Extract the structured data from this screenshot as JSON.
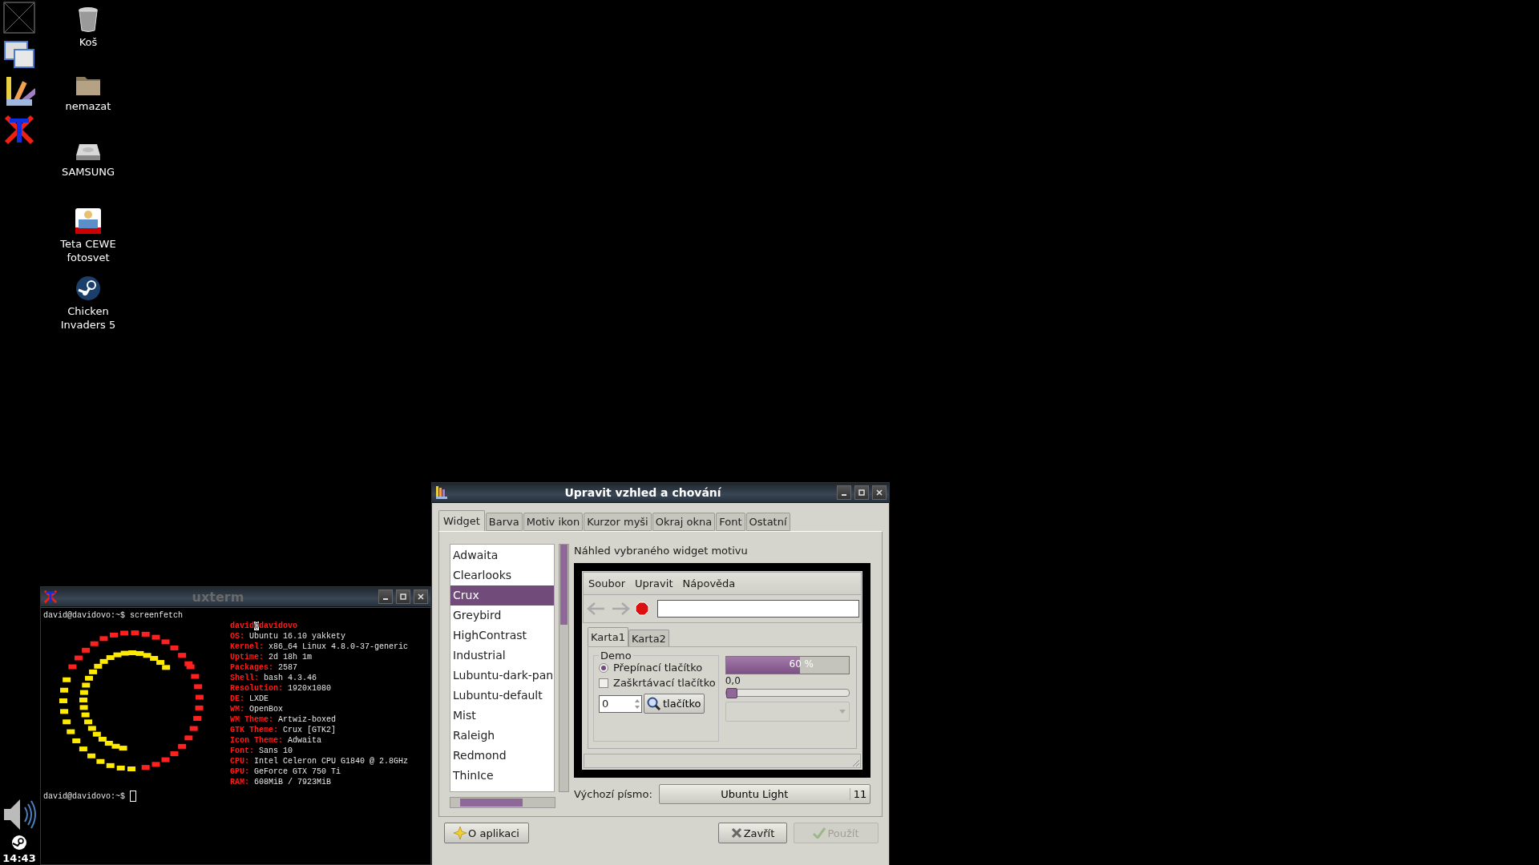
{
  "panel": {
    "clock": "14:43"
  },
  "desktop_icons": [
    {
      "label": "Koš",
      "kind": "trash"
    },
    {
      "label": "nemazat",
      "kind": "folder"
    },
    {
      "label": "SAMSUNG",
      "kind": "drive"
    },
    {
      "label": "Teta CEWE fotosvet",
      "kind": "photo"
    },
    {
      "label": "Chicken Invaders 5",
      "kind": "game"
    }
  ],
  "terminal": {
    "title": "uxterm",
    "prompt": "david@davidovo:~$",
    "command": "screenfetch",
    "user": "david",
    "at": "@",
    "host": "davidovo",
    "info": [
      {
        "label": "OS:",
        "value": "Ubuntu 16.10 yakkety"
      },
      {
        "label": "Kernel:",
        "value": "x86_64 Linux 4.8.0-37-generic"
      },
      {
        "label": "Uptime:",
        "value": "2d 18h 1m"
      },
      {
        "label": "Packages:",
        "value": "2587"
      },
      {
        "label": "Shell:",
        "value": "bash 4.3.46"
      },
      {
        "label": "Resolution:",
        "value": "1920x1080"
      },
      {
        "label": "DE:",
        "value": "LXDE"
      },
      {
        "label": "WM:",
        "value": "OpenBox"
      },
      {
        "label": "WM Theme:",
        "value": "Artwiz-boxed"
      },
      {
        "label": "GTK Theme:",
        "value": "Crux [GTK2]"
      },
      {
        "label": "Icon Theme:",
        "value": "Adwaita"
      },
      {
        "label": "Font:",
        "value": "Sans 10"
      },
      {
        "label": "CPU:",
        "value": "Intel Celeron CPU G1840 @ 2.8GHz"
      },
      {
        "label": "GPU:",
        "value": "GeForce GTX 750 Ti"
      },
      {
        "label": "RAM:",
        "value": "608MiB / 7923MiB"
      }
    ],
    "prompt2": "david@davidovo:~$"
  },
  "dialog": {
    "title": "Upravit vzhled a chování",
    "tabs": [
      {
        "label": "Widget",
        "selected": true
      },
      {
        "label": "Barva",
        "selected": false
      },
      {
        "label": "Motiv ikon",
        "selected": false
      },
      {
        "label": "Kurzor myši",
        "selected": false
      },
      {
        "label": "Okraj okna",
        "selected": false
      },
      {
        "label": "Font",
        "selected": false
      },
      {
        "label": "Ostatní",
        "selected": false
      }
    ],
    "themes": [
      {
        "label": "Adwaita",
        "selected": false
      },
      {
        "label": "Clearlooks",
        "selected": false
      },
      {
        "label": "Crux",
        "selected": true
      },
      {
        "label": "Greybird",
        "selected": false
      },
      {
        "label": "HighContrast",
        "selected": false
      },
      {
        "label": "Industrial",
        "selected": false
      },
      {
        "label": "Lubuntu-dark-pan",
        "selected": false
      },
      {
        "label": "Lubuntu-default",
        "selected": false
      },
      {
        "label": "Mist",
        "selected": false
      },
      {
        "label": "Raleigh",
        "selected": false
      },
      {
        "label": "Redmond",
        "selected": false
      },
      {
        "label": "ThinIce",
        "selected": false
      }
    ],
    "preview_label": "Náhled vybraného widget motivu",
    "preview": {
      "menu": [
        "Soubor",
        "Upravit",
        "Nápověda"
      ],
      "tabs": [
        {
          "label": "Karta1",
          "selected": true
        },
        {
          "label": "Karta2",
          "selected": false
        }
      ],
      "frame_label": "Demo",
      "radio": {
        "label": "Přepínací tlačítko",
        "checked": true
      },
      "checkbox": {
        "label": "Zaškrtávací tlačítko",
        "checked": false
      },
      "spin_value": "0",
      "button": "tlačítko",
      "progress": {
        "level": 0.6,
        "text": "60 %"
      },
      "slider": {
        "reading": "0,0",
        "level": 0
      }
    },
    "font_label": "Výchozí písmo:",
    "font_name": "Ubuntu Light",
    "font_size": "11",
    "buttons": [
      {
        "label": "O aplikaci",
        "kind": "about",
        "disabled": false
      },
      {
        "label": "Zavřít",
        "kind": "close",
        "disabled": false
      },
      {
        "label": "Použít",
        "kind": "apply",
        "disabled": true
      }
    ]
  }
}
